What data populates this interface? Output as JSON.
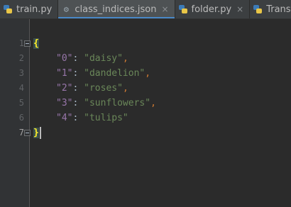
{
  "tabs": [
    {
      "label": "train.py",
      "icon": "python-file-icon",
      "active": false,
      "closable": false
    },
    {
      "label": "class_indices.json",
      "icon": "json-file-icon",
      "active": true,
      "closable": true
    },
    {
      "label": "folder.py",
      "icon": "python-file-icon",
      "active": false,
      "closable": true
    },
    {
      "label": "Transfer",
      "icon": "python-file-icon",
      "active": false,
      "closable": false
    }
  ],
  "close_glyph": "×",
  "line_numbers": [
    "1",
    "2",
    "3",
    "4",
    "5",
    "6",
    "7"
  ],
  "code": {
    "open_brace": "{",
    "close_brace": "}",
    "entries": [
      {
        "key": "\"0\"",
        "value": "\"daisy\"",
        "comma": ","
      },
      {
        "key": "\"1\"",
        "value": "\"dandelion\"",
        "comma": ","
      },
      {
        "key": "\"2\"",
        "value": "\"roses\"",
        "comma": ","
      },
      {
        "key": "\"3\"",
        "value": "\"sunflowers\"",
        "comma": ","
      },
      {
        "key": "\"4\"",
        "value": "\"tulips\"",
        "comma": ""
      }
    ]
  },
  "colors": {
    "editor_bg": "#2b2b2b",
    "key": "#9876aa",
    "string": "#6a8759",
    "punctuation": "#cc7832",
    "brace_match": "#ffef28",
    "tab_underline": "#4a88c7"
  }
}
